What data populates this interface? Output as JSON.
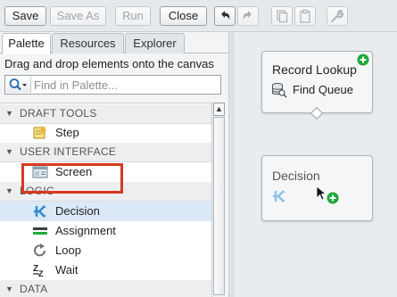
{
  "toolbar": {
    "save": "Save",
    "save_as": "Save As",
    "run": "Run",
    "close": "Close",
    "icons": [
      "undo-icon",
      "redo-icon",
      "copy-icon",
      "paste-icon",
      "wrench-icon"
    ]
  },
  "tabs": [
    {
      "label": "Palette",
      "active": true
    },
    {
      "label": "Resources",
      "active": false
    },
    {
      "label": "Explorer",
      "active": false
    }
  ],
  "palette": {
    "hint": "Drag and drop elements onto the canvas",
    "search_placeholder": "Find in Palette...",
    "sections": [
      {
        "label": "DRAFT TOOLS",
        "items": [
          {
            "label": "Step",
            "icon": "step-icon"
          }
        ]
      },
      {
        "label": "USER INTERFACE",
        "items": [
          {
            "label": "Screen",
            "icon": "screen-icon"
          }
        ]
      },
      {
        "label": "LOGIC",
        "items": [
          {
            "label": "Decision",
            "icon": "decision-icon",
            "selected": true
          },
          {
            "label": "Assignment",
            "icon": "assignment-icon"
          },
          {
            "label": "Loop",
            "icon": "loop-icon"
          },
          {
            "label": "Wait",
            "icon": "wait-icon"
          }
        ]
      },
      {
        "label": "DATA",
        "items": []
      }
    ]
  },
  "canvas": {
    "record_lookup": {
      "title": "Record Lookup",
      "subtitle": "Find Queue"
    },
    "decision": {
      "title": "Decision"
    }
  },
  "colors": {
    "accent_green": "#1fa83a",
    "highlight_red": "#d63a1e",
    "decision_blue": "#2d8bd0"
  }
}
